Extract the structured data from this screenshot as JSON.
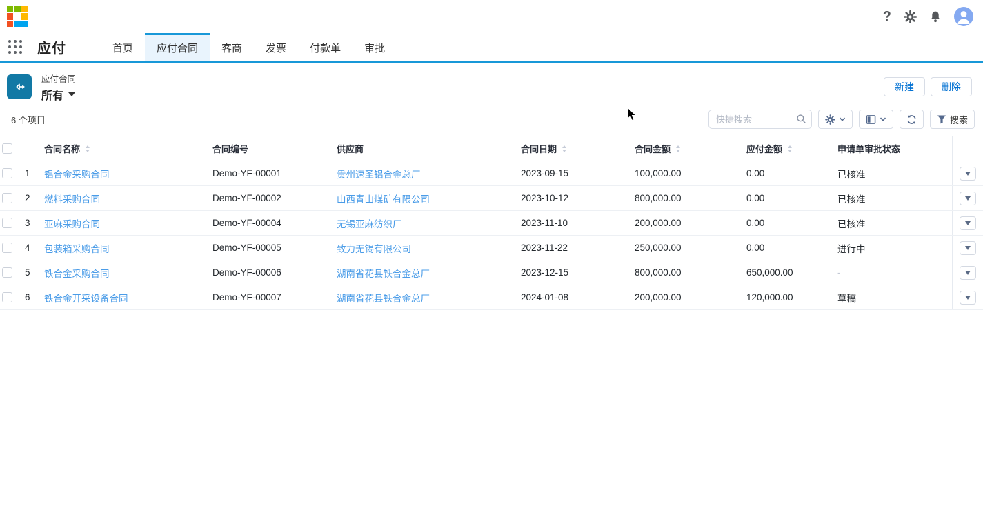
{
  "topbar": {
    "icons": [
      "brand-logo",
      "help",
      "settings",
      "notifications",
      "account"
    ]
  },
  "nav": {
    "app_title": "应付",
    "tabs": [
      {
        "label": "首页",
        "active": false
      },
      {
        "label": "应付合同",
        "active": true
      },
      {
        "label": "客商",
        "active": false
      },
      {
        "label": "发票",
        "active": false
      },
      {
        "label": "付款单",
        "active": false
      },
      {
        "label": "审批",
        "active": false
      }
    ]
  },
  "page_header": {
    "entity_label": "应付合同",
    "view_name": "所有",
    "new_label": "新建",
    "delete_label": "删除"
  },
  "toolbar": {
    "item_count": "6 个项目",
    "search_placeholder": "快捷搜索",
    "filter_label": "搜索"
  },
  "table": {
    "columns": [
      {
        "label": "合同名称",
        "sortable": true
      },
      {
        "label": "合同编号",
        "sortable": false
      },
      {
        "label": "供应商",
        "sortable": false
      },
      {
        "label": "合同日期",
        "sortable": true
      },
      {
        "label": "合同金额",
        "sortable": true
      },
      {
        "label": "应付金额",
        "sortable": true
      },
      {
        "label": "申请单审批状态",
        "sortable": false
      }
    ],
    "rows": [
      {
        "num": "1",
        "name": "铝合金采购合同",
        "code": "Demo-YF-00001",
        "supplier": "贵州速圣铝合金总厂",
        "date": "2023-09-15",
        "amount": "100,000.00",
        "payable": "0.00",
        "status": "已核准"
      },
      {
        "num": "2",
        "name": "燃料采购合同",
        "code": "Demo-YF-00002",
        "supplier": "山西青山煤矿有限公司",
        "date": "2023-10-12",
        "amount": "800,000.00",
        "payable": "0.00",
        "status": "已核准"
      },
      {
        "num": "3",
        "name": "亚麻采购合同",
        "code": "Demo-YF-00004",
        "supplier": "无锡亚麻纺织厂",
        "date": "2023-11-10",
        "amount": "200,000.00",
        "payable": "0.00",
        "status": "已核准"
      },
      {
        "num": "4",
        "name": "包装箱采购合同",
        "code": "Demo-YF-00005",
        "supplier": "致力无锡有限公司",
        "date": "2023-11-22",
        "amount": "250,000.00",
        "payable": "0.00",
        "status": "进行中"
      },
      {
        "num": "5",
        "name": "铁合金采购合同",
        "code": "Demo-YF-00006",
        "supplier": "湖南省花县铁合金总厂",
        "date": "2023-12-15",
        "amount": "800,000.00",
        "payable": "650,000.00",
        "status": "-"
      },
      {
        "num": "6",
        "name": "铁合金开采设备合同",
        "code": "Demo-YF-00007",
        "supplier": "湖南省花县铁合金总厂",
        "date": "2024-01-08",
        "amount": "200,000.00",
        "payable": "120,000.00",
        "status": "草稿"
      }
    ]
  },
  "colors": {
    "accent_blue": "#1898d8",
    "link_blue": "#4a9ce8",
    "button_text_blue": "#0070d2",
    "entity_icon_bg": "#1279a5",
    "active_tab_bg": "#e9f4fd",
    "avatar_bg": "#84a9f1",
    "logo_green": "#7fba00",
    "logo_amber": "#ffb900",
    "logo_red": "#f25022",
    "logo_blue": "#00a4ef"
  }
}
